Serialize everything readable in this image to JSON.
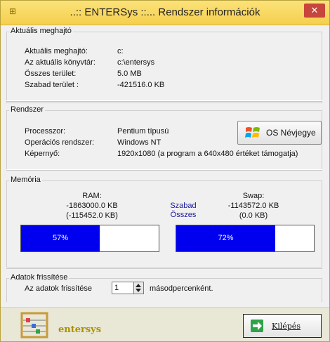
{
  "window": {
    "title": "..:: ENTERSys ::... Rendszer információk",
    "close": "✕"
  },
  "drive": {
    "legend": "Aktuális meghajtó",
    "rows": [
      {
        "label": "Aktuális meghajtó:",
        "value": "c:"
      },
      {
        "label": "Az aktuális könyvtár:",
        "value": "c:\\entersys"
      },
      {
        "label": "Összes terület:",
        "value": "5.0 MB"
      },
      {
        "label": "Szabad terület :",
        "value": "-421516.0 KB"
      }
    ]
  },
  "system": {
    "legend": "Rendszer",
    "rows": [
      {
        "label": "Processzor:",
        "value": "Pentium típusú"
      },
      {
        "label": "Operációs rendszer:",
        "value": "Windows NT"
      },
      {
        "label": "Képernyő:",
        "value": "1920x1080   (a program a 640x480 értéket támogatja)"
      }
    ],
    "os_button": "OS Névjegye"
  },
  "memory": {
    "legend": "Memória",
    "ram": {
      "title": "RAM:",
      "free": "-1863000.0 KB",
      "total": "(-115452.0 KB)",
      "percent_text": "57%",
      "fill_fraction": 0.57
    },
    "legend_free": "Szabad",
    "legend_total": "Összes",
    "swap": {
      "title": "Swap:",
      "free": "-1143572.0 KB",
      "total": "(0.0 KB)",
      "percent_text": "72%",
      "fill_fraction": 0.72
    }
  },
  "refresh": {
    "legend": "Adatok frissítése",
    "label": "Az adatok frissítése",
    "value": "1",
    "unit": "másodpercenként."
  },
  "footer": {
    "brand": "entersys",
    "exit_label": "Kilépés"
  },
  "colors": {
    "titlebar": "#f5cf4e",
    "bar_fill": "#0000ee",
    "close": "#c7453b",
    "brand": "#a89200"
  }
}
